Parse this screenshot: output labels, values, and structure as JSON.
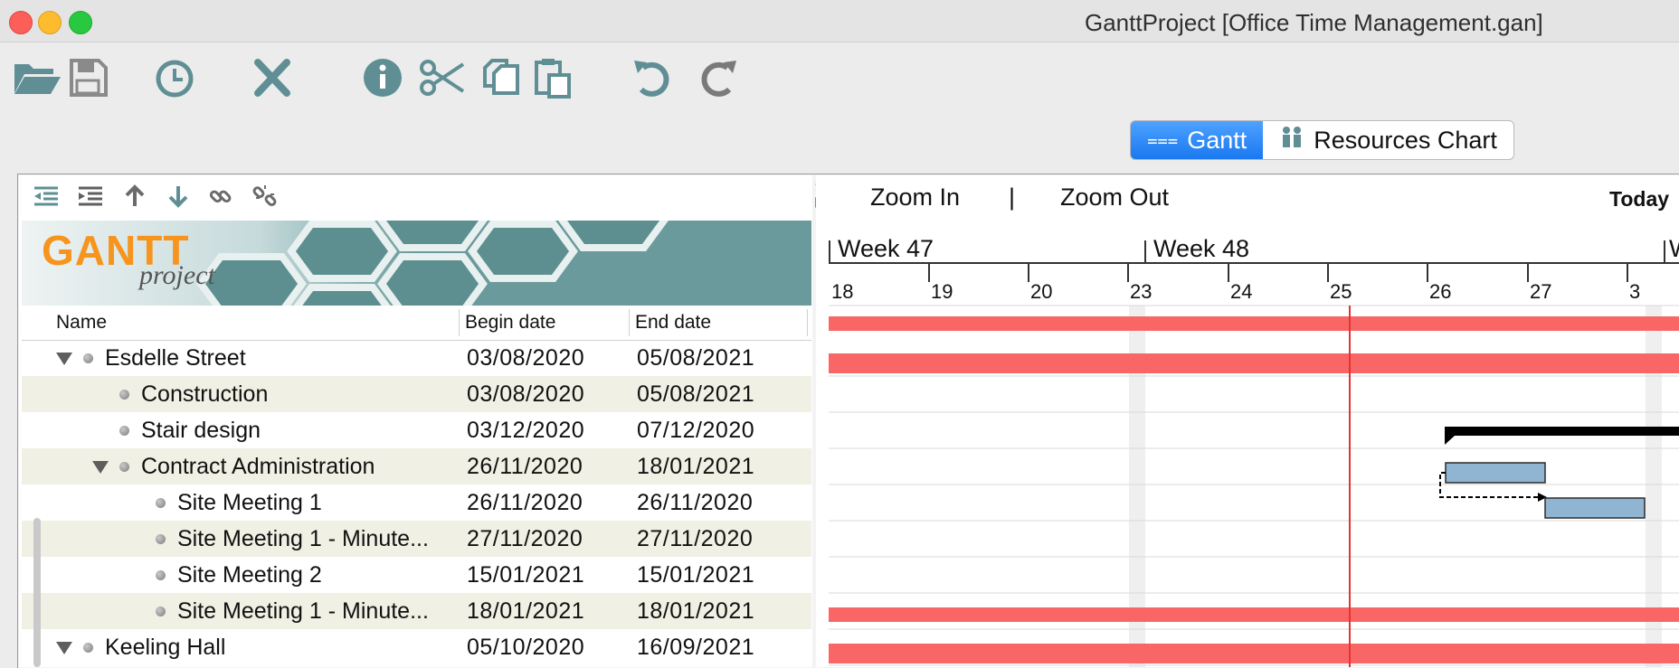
{
  "window": {
    "title": "GanttProject [Office Time Management.gan]"
  },
  "toolbar": {
    "buttons": [
      "open-icon",
      "save-icon",
      "history-icon",
      "delete-icon",
      "info-icon",
      "cut-icon",
      "copy-icon",
      "paste-icon",
      "undo-icon",
      "redo-icon"
    ]
  },
  "tabs": [
    {
      "label": "Gantt",
      "active": true
    },
    {
      "label": "Resources Chart",
      "active": false
    }
  ],
  "tree_toolbar": [
    "outdent-icon",
    "indent-icon",
    "move-up-icon",
    "move-down-icon",
    "link-icon",
    "unlink-icon"
  ],
  "banner": {
    "logo_word1": "GANTT",
    "logo_word2": "project"
  },
  "table": {
    "headers": {
      "name": "Name",
      "begin": "Begin date",
      "end": "End date"
    },
    "rows": [
      {
        "name": "Esdelle Street",
        "begin": "03/08/2020",
        "end": "05/08/2021",
        "level": 0,
        "expandable": true
      },
      {
        "name": "Construction",
        "begin": "03/08/2020",
        "end": "05/08/2021",
        "level": 1,
        "expandable": false
      },
      {
        "name": "Stair design",
        "begin": "03/12/2020",
        "end": "07/12/2020",
        "level": 1,
        "expandable": false
      },
      {
        "name": "Contract Administration",
        "begin": "26/11/2020",
        "end": "18/01/2021",
        "level": 1,
        "expandable": true
      },
      {
        "name": "Site Meeting 1",
        "begin": "26/11/2020",
        "end": "26/11/2020",
        "level": 2,
        "expandable": false
      },
      {
        "name": "Site Meeting 1 - Minute...",
        "begin": "27/11/2020",
        "end": "27/11/2020",
        "level": 2,
        "expandable": false
      },
      {
        "name": "Site Meeting 2",
        "begin": "15/01/2021",
        "end": "15/01/2021",
        "level": 2,
        "expandable": false
      },
      {
        "name": "Site Meeting 1 - Minute...",
        "begin": "18/01/2021",
        "end": "18/01/2021",
        "level": 2,
        "expandable": false
      },
      {
        "name": "Keeling Hall",
        "begin": "05/10/2020",
        "end": "16/09/2021",
        "level": 0,
        "expandable": true
      }
    ]
  },
  "chart": {
    "zoom_in": "Zoom In",
    "separator": "|",
    "zoom_out": "Zoom Out",
    "today": "Today",
    "weeks": [
      "Week 47",
      "Week 48",
      "W"
    ],
    "days": [
      "18",
      "19",
      "20",
      "23",
      "24",
      "25",
      "26",
      "27",
      "3"
    ],
    "colors": {
      "summary_bar": "#f96666",
      "task_bar": "#8fb5d3",
      "today_line": "#e53333",
      "weekend": "#efefef"
    }
  }
}
